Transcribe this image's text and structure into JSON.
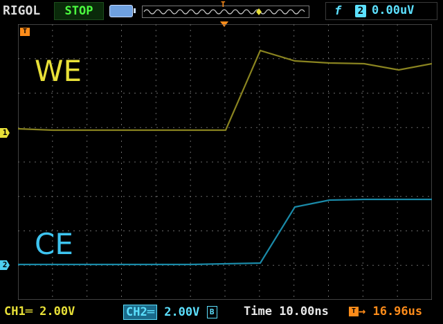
{
  "header": {
    "brand": "RIGOL",
    "run_status": "STOP",
    "trigger": {
      "edge_symbol": "f",
      "source_channel": "2",
      "level": "0.00uV"
    },
    "top_trigger_marker": "T"
  },
  "screen": {
    "trigger_marker": "T",
    "channel_markers": {
      "ch1": "1",
      "ch2": "2"
    },
    "labels": {
      "ch1": "WE",
      "ch2": "CE"
    }
  },
  "footer": {
    "ch1_label": "CH1═ 2.00V",
    "ch2_tag": "CH2═",
    "ch2_scale": "2.00V",
    "ch2_bw": "B",
    "timebase_label": "Time",
    "timebase_value": "10.00ns",
    "trigger_position_marker": "T",
    "trigger_position": "→ 16.96us"
  },
  "colors": {
    "ch1": "#e8e038",
    "ch2": "#3ec4f0",
    "trigger": "#ff8c1a",
    "grid": "#6a6a6a"
  },
  "waveforms": {
    "ch1": {
      "low_level": "baseline",
      "high_level": "elevated",
      "edge": "rising"
    },
    "ch2": {
      "low_level": "baseline",
      "high_level": "elevated",
      "edge": "rising"
    }
  }
}
